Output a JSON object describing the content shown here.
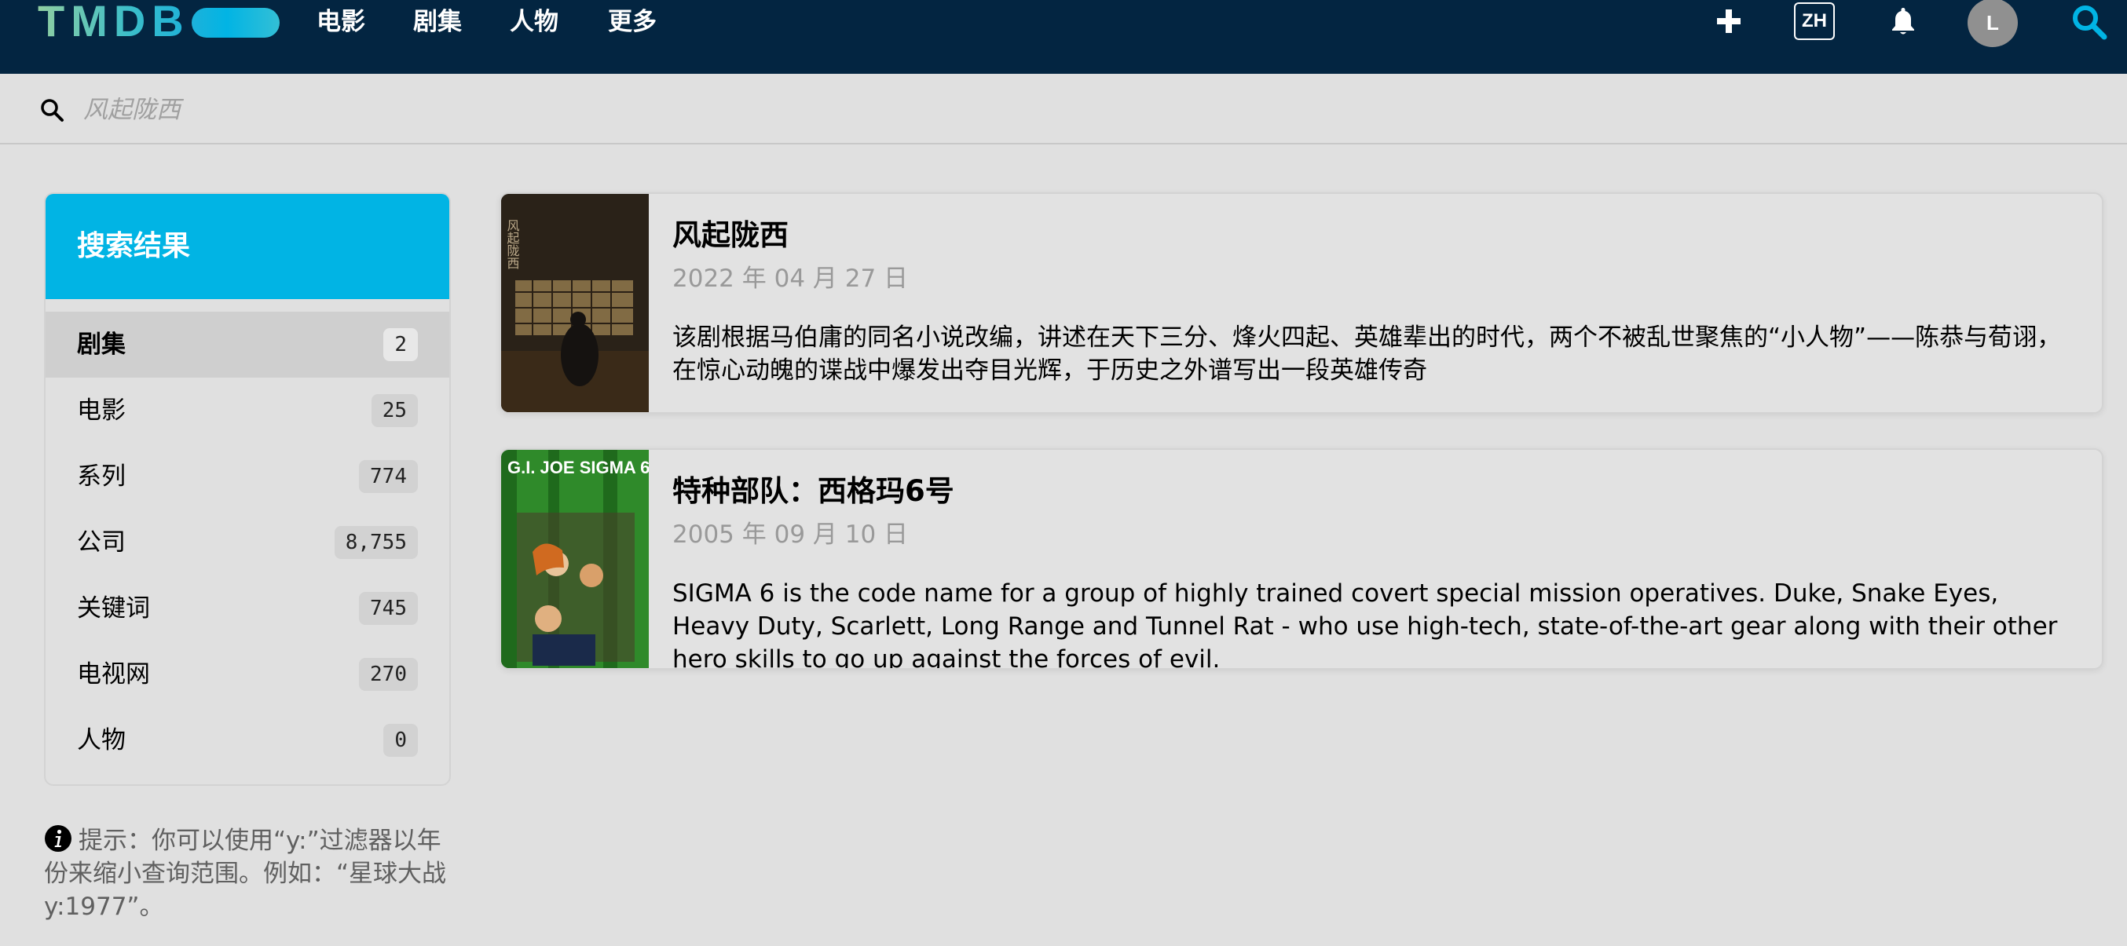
{
  "nav": {
    "logo": "TMDB",
    "links": [
      "电影",
      "剧集",
      "人物",
      "更多"
    ],
    "language": "ZH",
    "avatar_initial": "L",
    "icons": [
      "plus-icon",
      "bell-icon",
      "search-icon"
    ]
  },
  "search": {
    "value": "",
    "placeholder": "风起陇西"
  },
  "sidebar": {
    "title": "搜索结果",
    "items": [
      {
        "label": "剧集",
        "count": "2",
        "active": true
      },
      {
        "label": "电影",
        "count": "25"
      },
      {
        "label": "系列",
        "count": "774"
      },
      {
        "label": "公司",
        "count": "8,755"
      },
      {
        "label": "关键词",
        "count": "745"
      },
      {
        "label": "电视网",
        "count": "270"
      },
      {
        "label": "人物",
        "count": "0"
      }
    ]
  },
  "tip": {
    "text": "提示：你可以使用“y:”过滤器以年份来缩小查询范围。例如：“星球大战 y:1977”。"
  },
  "results": [
    {
      "title": "风起陇西",
      "date": "2022 年 04 月 27 日",
      "overview": "该剧根据马伯庸的同名小说改编，讲述在天下三分、烽火四起、英雄辈出的时代，两个不被乱世聚焦的“小人物”——陈恭与荀诩，在惊心动魄的谍战中爆发出夺目光辉，于历史之外谱写出一段英雄传奇",
      "poster_text": "风起陇西"
    },
    {
      "title": "特种部队：西格玛6号",
      "date": "2005 年 09 月 10 日",
      "overview": "SIGMA 6 is the code name for a group of highly trained covert special mission operatives. Duke, Snake Eyes, Heavy Duty, Scarlett, Long Range and Tunnel Rat - who use high-tech, state-of-the-art gear along with their other hero skills to go up against the forces of evil.",
      "poster_text": "G.I. JOE SIGMA 6"
    }
  ],
  "colors": {
    "nav_bg": "#032541",
    "accent": "#01b4e4",
    "logo_green": "#90cea1"
  }
}
